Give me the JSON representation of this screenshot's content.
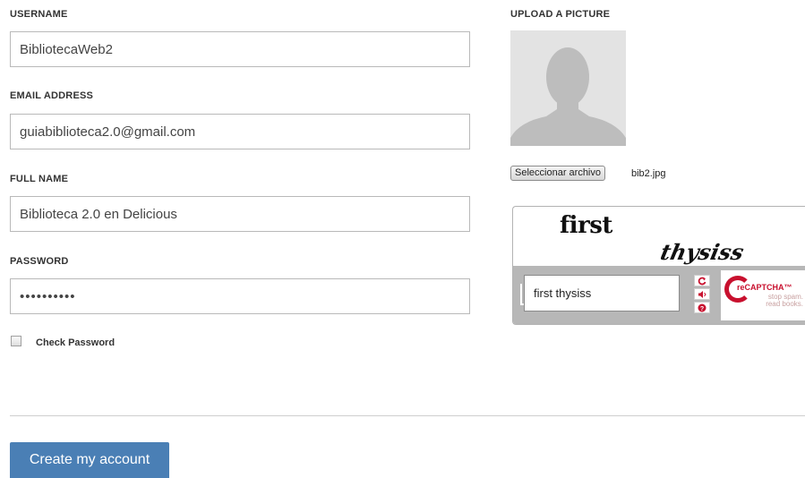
{
  "form": {
    "username": {
      "label": "USERNAME",
      "value": "BibliotecaWeb2"
    },
    "email": {
      "label": "EMAIL ADDRESS",
      "value": "guiabiblioteca2.0@gmail.com"
    },
    "fullname": {
      "label": "FULL NAME",
      "value": "Biblioteca 2.0 en Delicious"
    },
    "password": {
      "label": "PASSWORD",
      "value": "••••••••••"
    },
    "check_password": {
      "label": "Check Password",
      "checked": false
    },
    "submit_label": "Create my account"
  },
  "upload": {
    "label": "UPLOAD A PICTURE",
    "button_label": "Seleccionar archivo",
    "file_name": "bib2.jpg"
  },
  "captcha": {
    "word1": "first",
    "word2": "thysiss",
    "input_value": "first thysiss",
    "logo_text": "reCAPTCHA™",
    "tagline_1": "stop spam.",
    "tagline_2": "read books.",
    "icons": [
      "refresh-icon",
      "audio-icon",
      "help-icon"
    ],
    "accent_color": "#c8102e"
  },
  "colors": {
    "button_bg": "#4a7fb5"
  }
}
